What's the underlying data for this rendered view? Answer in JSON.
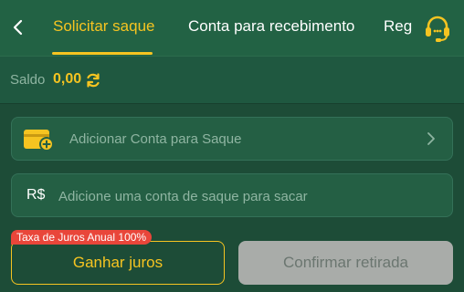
{
  "header": {
    "tabs": [
      {
        "label": "Solicitar saque",
        "active": true
      },
      {
        "label": "Conta para recebimento",
        "active": false
      },
      {
        "label": "Registro de saque",
        "active": false
      }
    ],
    "back_icon": "chevron-left-icon",
    "support_icon": "headset-icon"
  },
  "balance": {
    "label": "Saldo",
    "value": "0,00",
    "refresh_icon": "refresh-icon"
  },
  "account": {
    "label": "Adicionar Conta para Saque",
    "icon": "wallet-add-icon",
    "chevron_icon": "chevron-right-icon"
  },
  "amount": {
    "currency": "R$",
    "placeholder": "Adicione uma conta de saque para sacar",
    "value": ""
  },
  "interest": {
    "badge": "Taxa de Juros Anual 100%",
    "button_label": "Ganhar juros"
  },
  "confirm": {
    "button_label": "Confirmar retirada",
    "enabled": false
  },
  "colors": {
    "background": "#1d4c37",
    "header": "#226244",
    "accent": "#f6c421",
    "badge": "#e9463a",
    "disabled_button": "#a9aca9"
  }
}
